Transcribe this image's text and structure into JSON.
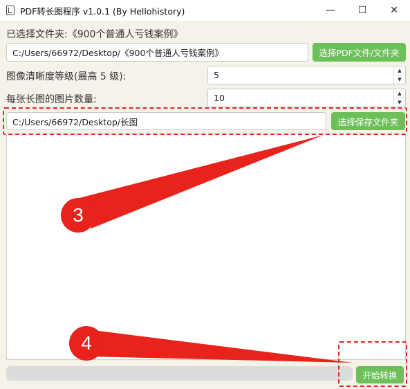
{
  "window": {
    "title": "PDF转长图程序 v1.0.1 (By Hellohistory)",
    "controls": {
      "minimize": "—",
      "maximize": "☐",
      "close": "✕"
    }
  },
  "folder_label": "已选择文件夹:《900个普通人亏钱案例》",
  "pdf_path": "C:/Users/66972/Desktop/《900个普通人亏钱案例》",
  "select_pdf_button": "选择PDF文件/文件夹",
  "quality": {
    "label": "图像清晰度等级(最高 5 级):",
    "value": "5"
  },
  "pages": {
    "label": "每张长图的图片数量:",
    "value": "10"
  },
  "save_path": "C:/Users/66972/Desktop/长图",
  "select_save_button": "选择保存文件夹",
  "log_text": "",
  "progress_percent": 0,
  "start_button": "开始转换",
  "annotations": {
    "step3": "3",
    "step4": "4",
    "color": "#e8231b"
  },
  "colors": {
    "button_green": "#6dbf5a",
    "background": "#f5f2e9"
  }
}
